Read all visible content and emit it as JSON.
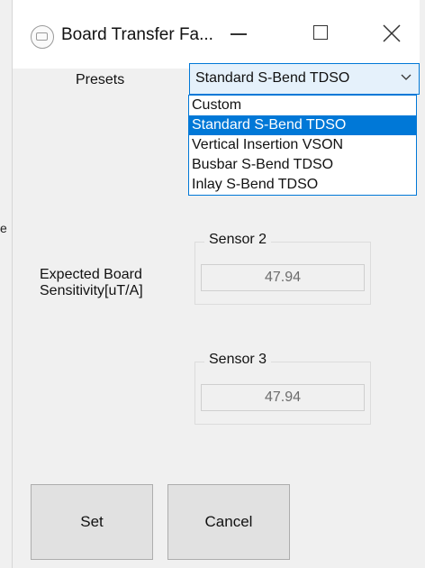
{
  "window": {
    "title": "Board Transfer Fa..."
  },
  "edge": {
    "glyph": "e"
  },
  "presets": {
    "label": "Presets",
    "selected": "Standard S-Bend TDSO",
    "options": [
      "Custom",
      "Standard S-Bend TDSO",
      "Vertical Insertion VSON",
      "Busbar S-Bend TDSO",
      "Inlay S-Bend TDSO"
    ],
    "highlighted_index": 1
  },
  "sensitivity": {
    "label_line1": "Expected Board",
    "label_line2": "Sensitivity[uT/A]"
  },
  "sensor2": {
    "title": "Sensor 2",
    "value": "47.94"
  },
  "sensor3": {
    "title": "Sensor 3",
    "value": "47.94"
  },
  "buttons": {
    "set": "Set",
    "cancel": "Cancel"
  },
  "colors": {
    "accent": "#0078d7",
    "background": "#f0f0f0",
    "combo_bg": "#e5f1fb"
  },
  "icons": {
    "app": "app-icon",
    "minimize": "minimize-icon",
    "maximize": "maximize-icon",
    "close": "close-icon",
    "dropdown": "chevron-down-icon"
  }
}
